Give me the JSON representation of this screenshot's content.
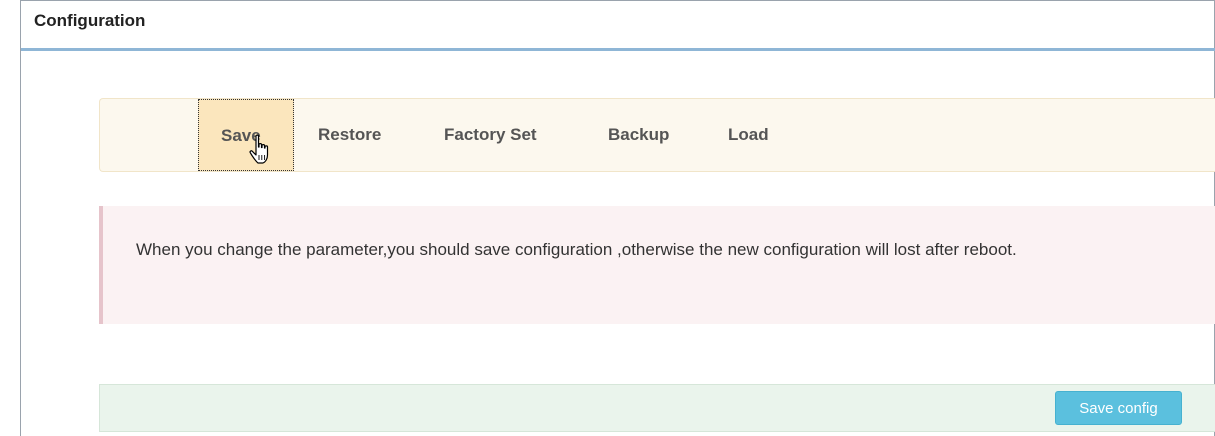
{
  "panel": {
    "title": "Configuration"
  },
  "tabs": [
    {
      "label": "Save",
      "active": true
    },
    {
      "label": "Restore",
      "active": false
    },
    {
      "label": "Factory Set",
      "active": false
    },
    {
      "label": "Backup",
      "active": false
    },
    {
      "label": "Load",
      "active": false
    }
  ],
  "alert": {
    "message": "When you change the parameter,you should save configuration ,otherwise the new configuration will lost after reboot."
  },
  "footer": {
    "save_button_label": "Save config"
  },
  "colors": {
    "accent_button": "#5bc0de",
    "active_tab_bg": "#fbe6bd",
    "alert_bg": "#fbf2f3",
    "footer_bg": "#eaf4ec",
    "title_rule": "#8fb6d6"
  },
  "cursor": {
    "icon": "hand-pointer-icon"
  }
}
